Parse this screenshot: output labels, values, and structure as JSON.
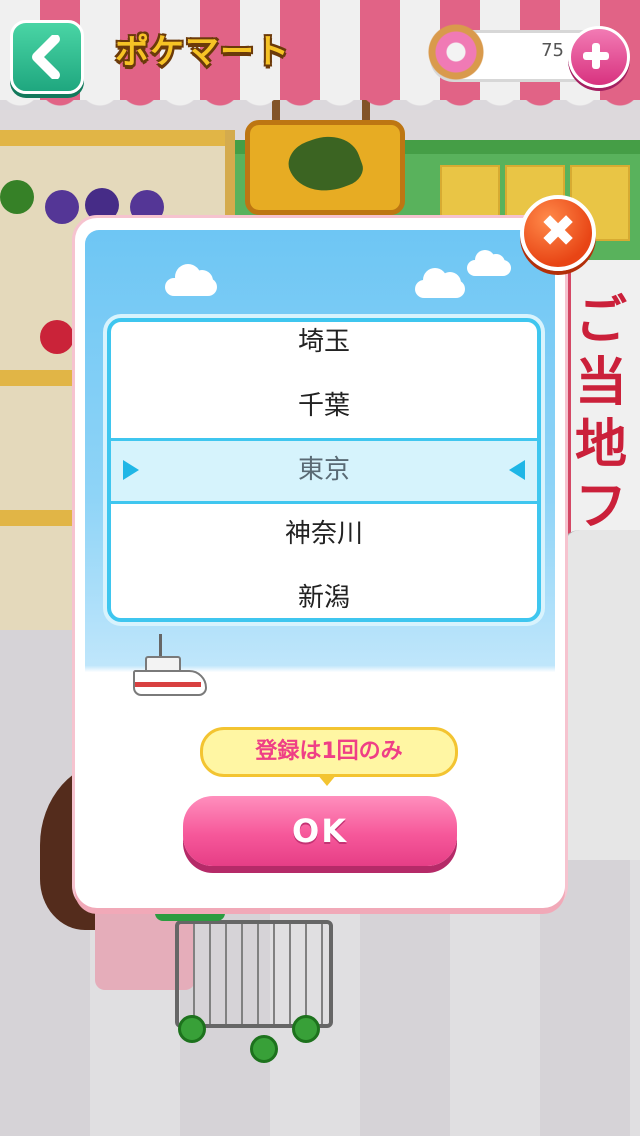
{
  "header": {
    "title": "ポケマート",
    "currency_amount": "75"
  },
  "modal": {
    "prefecture_options": [
      "埼玉",
      "千葉",
      "東京",
      "神奈川",
      "新潟"
    ],
    "selected_option": "東京",
    "note": "登録は1回のみ",
    "ok_label": "OK",
    "close_label": "✖"
  },
  "background": {
    "poster_text": "ご当地フ"
  },
  "colors": {
    "accent_pink": "#f6589a",
    "picker_border": "#3fc6ef",
    "title_yellow": "#f6c325"
  },
  "icons": [
    "back-arrow-icon",
    "donut-icon",
    "plus-icon",
    "close-icon",
    "arrow-left-icon",
    "arrow-right-icon",
    "boat-icon"
  ]
}
